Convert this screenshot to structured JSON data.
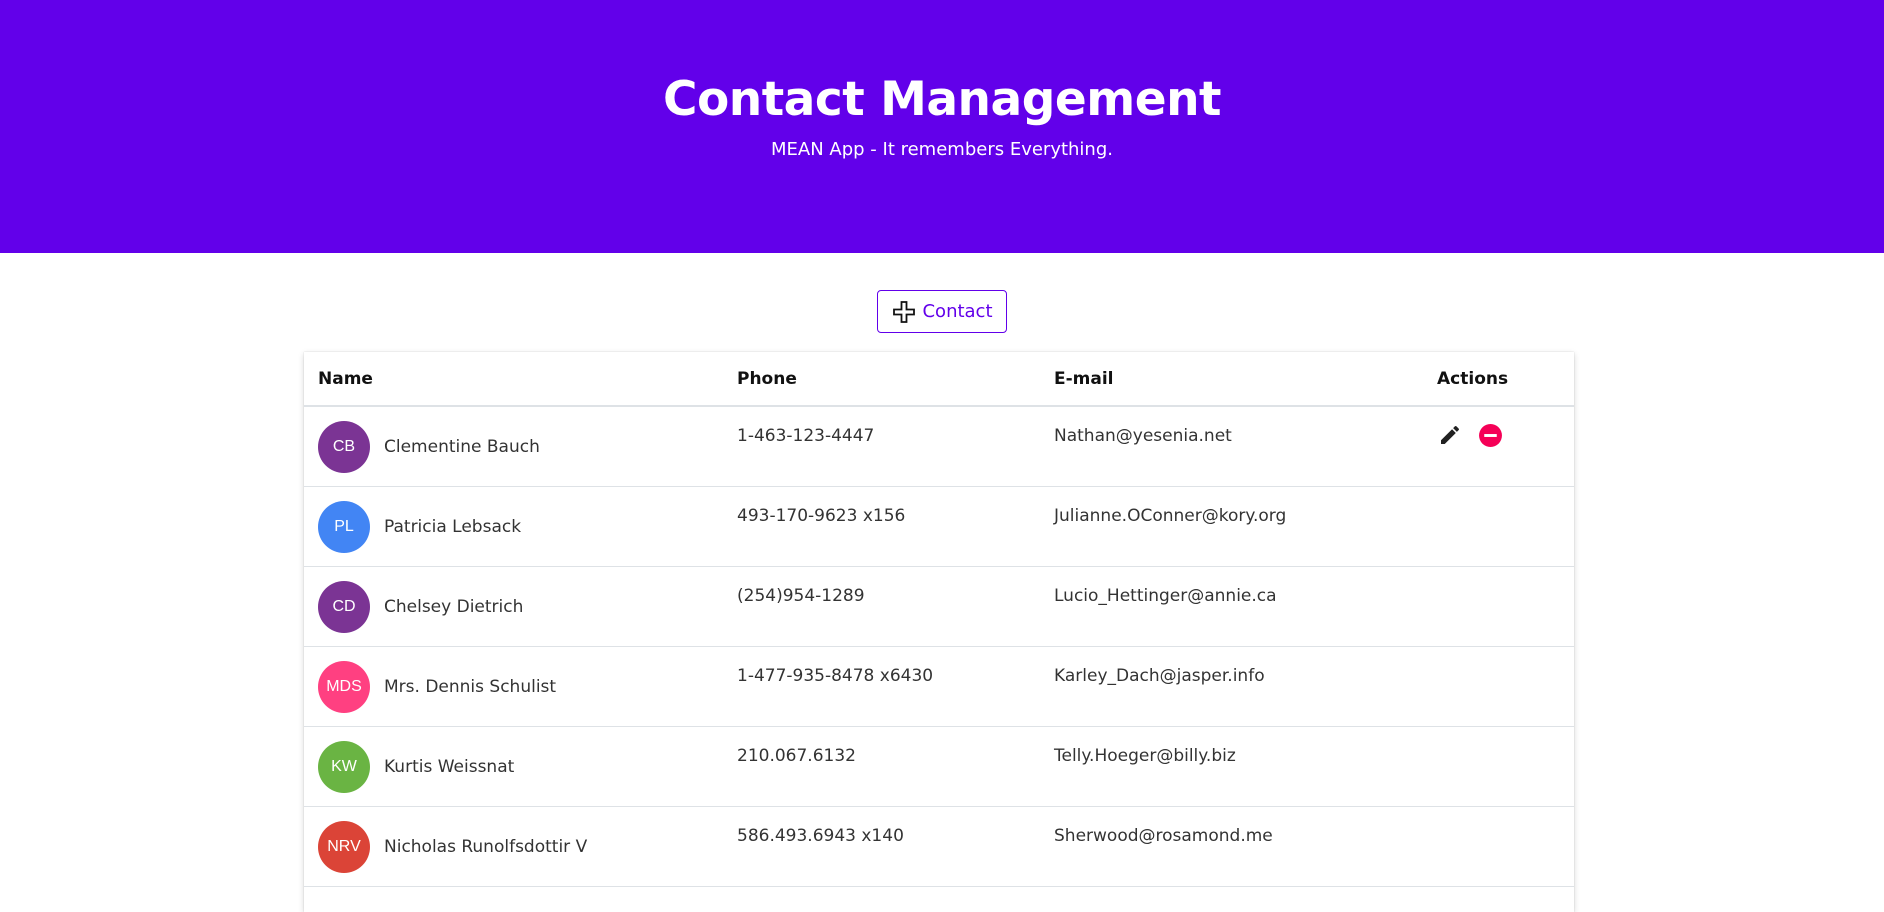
{
  "header": {
    "title": "Contact Management",
    "subtitle": "MEAN App - It remembers Everything."
  },
  "toolbar": {
    "add_label": "Contact",
    "add_icon": "plus-icon"
  },
  "table": {
    "columns": [
      "Name",
      "Phone",
      "E-mail",
      "Actions"
    ],
    "rows": [
      {
        "initials": "CB",
        "avatar_color": "#7b3494",
        "name": "Clementine Bauch",
        "phone": "1-463-123-4447",
        "email": "Nathan@yesenia.net"
      },
      {
        "initials": "PL",
        "avatar_color": "#4285f4",
        "name": "Patricia Lebsack",
        "phone": "493-170-9623 x156",
        "email": "Julianne.OConner@kory.org"
      },
      {
        "initials": "CD",
        "avatar_color": "#7b3494",
        "name": "Chelsey Dietrich",
        "phone": "(254)954-1289",
        "email": "Lucio_Hettinger@annie.ca"
      },
      {
        "initials": "MDS",
        "avatar_color": "#ff4081",
        "name": "Mrs. Dennis Schulist",
        "phone": "1-477-935-8478 x6430",
        "email": "Karley_Dach@jasper.info"
      },
      {
        "initials": "KW",
        "avatar_color": "#6ab443",
        "name": "Kurtis Weissnat",
        "phone": "210.067.6132",
        "email": "Telly.Hoeger@billy.biz"
      },
      {
        "initials": "NRV",
        "avatar_color": "#db4437",
        "name": "Nicholas Runolfsdottir V",
        "phone": "586.493.6943 x140",
        "email": "Sherwood@rosamond.me"
      }
    ],
    "row_actions": [
      "edit-icon",
      "remove-icon"
    ]
  },
  "colors": {
    "primary": "#6200ea",
    "danger": "#f50057"
  }
}
